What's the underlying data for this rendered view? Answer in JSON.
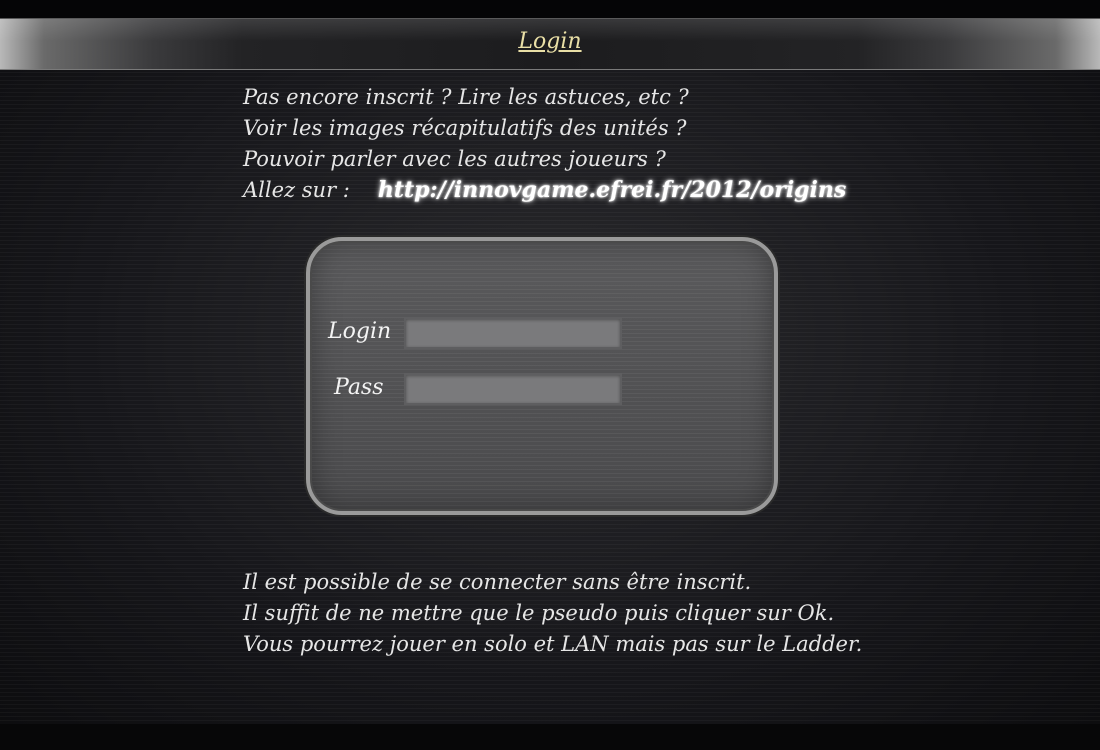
{
  "header": {
    "title": "Login"
  },
  "intro": {
    "lines": [
      "Pas encore inscrit ? Lire les astuces, etc ?",
      "Voir les images récapitulatifs des unités ?",
      "Pouvoir parler avec les autres joueurs ?"
    ],
    "goto_label": "Allez sur :",
    "url": "http://innovgame.efrei.fr/2012/origins"
  },
  "login_form": {
    "login_label": "Login",
    "login_value": "",
    "pass_label": "Pass",
    "pass_value": ""
  },
  "footer": {
    "lines": [
      "Il est possible de se connecter sans être inscrit.",
      "Il suffit de ne mettre que le pseudo puis cliquer sur Ok.",
      "Vous pourrez jouer en solo et LAN mais pas sur le Ladder."
    ]
  }
}
